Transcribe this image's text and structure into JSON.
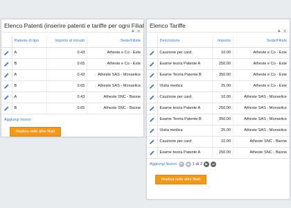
{
  "left_panel": {
    "title": "Elenco Patenti (inserire patenti e tariffe per ogni Filiale)",
    "controls": {
      "collapse": "▲",
      "close": "✕"
    },
    "columns": [
      "Patente di tipo",
      "Importo al minuto",
      "Sede/Filiale"
    ],
    "rows": [
      {
        "patente": "A",
        "importo": "0.43",
        "sede": "Atheste e Co - Este"
      },
      {
        "patente": "B",
        "importo": "0.65",
        "sede": "Atheste e Co - Este"
      },
      {
        "patente": "A",
        "importo": "0.43",
        "sede": "Atheste SAS - Monselice"
      },
      {
        "patente": "B",
        "importo": "0.65",
        "sede": "Atheste SAS - Monselice"
      },
      {
        "patente": "A",
        "importo": "0.43",
        "sede": "Atheste SNC - Baone"
      },
      {
        "patente": "B",
        "importo": "0.65",
        "sede": "Atheste SNC - Baone"
      }
    ],
    "add_label": "Aggiungi nuovo",
    "replica_label": "Replica nelle altre filiali"
  },
  "right_panel": {
    "title": "Elenco Tariffe",
    "controls": {
      "collapse": "▲",
      "close": "✕"
    },
    "columns": [
      "Descrizione",
      "Importo",
      "Sede/Filiale"
    ],
    "rows": [
      {
        "descrizione": "Cauzione per card",
        "importo": "10.00",
        "sede": "Atheste e Co - Este"
      },
      {
        "descrizione": "Esame teoria Patente A",
        "importo": "250.00",
        "sede": "Atheste e Co - Este"
      },
      {
        "descrizione": "Esame Teoria Patente B",
        "importo": "350.00",
        "sede": "Atheste e Co - Este"
      },
      {
        "descrizione": "Visita medica",
        "importo": "25.00",
        "sede": "Atheste e Co - Este"
      },
      {
        "descrizione": "Cauzione per card",
        "importo": "10.00",
        "sede": "Atheste SAS - Monselice"
      },
      {
        "descrizione": "Esame teoria Patente A",
        "importo": "250.00",
        "sede": "Atheste SAS - Monselice"
      },
      {
        "descrizione": "Esame Teoria Patente B",
        "importo": "350.00",
        "sede": "Atheste SAS - Monselice"
      },
      {
        "descrizione": "Visita medica",
        "importo": "25.00",
        "sede": "Atheste SAS - Monselice"
      },
      {
        "descrizione": "Cauzione per card",
        "importo": "10.00",
        "sede": "Atheste SNC - Baone"
      },
      {
        "descrizione": "Esame teoria Patente A",
        "importo": "250.00",
        "sede": "Atheste SNC - Baone"
      }
    ],
    "add_label": "Aggiungi Nuovo",
    "pager": {
      "first": "⏮",
      "prev": "◀",
      "current": "1",
      "of_label": "di",
      "total": "2",
      "next": "▶",
      "last": "⏭"
    },
    "replica_label": "Replica nelle altre filiali"
  },
  "colors": {
    "header_text": "#3a78c2",
    "button_bg": "#f29a18",
    "background": "#e9ecef"
  },
  "icons": {
    "row_action": "pencil-icon"
  }
}
